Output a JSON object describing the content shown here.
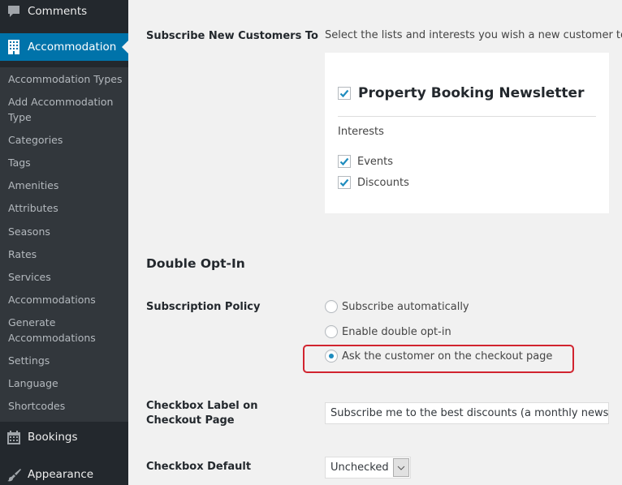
{
  "sidebar": {
    "top_items": [
      {
        "label": "Comments",
        "icon": "comment-icon"
      },
      {
        "label": "Accommodation",
        "icon": "building-icon",
        "active": true
      },
      {
        "label": "Bookings",
        "icon": "calendar-icon"
      },
      {
        "label": "Appearance",
        "icon": "paintbrush-icon"
      }
    ],
    "submenu": [
      "Accommodation Types",
      "Add Accommodation Type",
      "Categories",
      "Tags",
      "Amenities",
      "Attributes",
      "Seasons",
      "Rates",
      "Services",
      "Accommodations",
      "Generate Accommodations",
      "Settings",
      "Language",
      "Shortcodes"
    ]
  },
  "settings": {
    "subscribe_label": "Subscribe New Customers To",
    "subscribe_desc": "Select the lists and interests you wish a new customer to be",
    "list": {
      "name": "Property Booking Newsletter",
      "checked": true
    },
    "interests_title": "Interests",
    "interests": [
      {
        "label": "Events",
        "checked": true
      },
      {
        "label": "Discounts",
        "checked": true
      }
    ],
    "double_optin_title": "Double Opt-In",
    "policy_label": "Subscription Policy",
    "policy_options": [
      {
        "label": "Subscribe automatically",
        "selected": false
      },
      {
        "label": "Enable double opt-in",
        "selected": false
      },
      {
        "label": "Ask the customer on the checkout page",
        "selected": true
      }
    ],
    "checkbox_label_label": "Checkbox Label on Checkout Page",
    "checkbox_label_value": "Subscribe me to the best discounts (a monthly newslett",
    "checkbox_default_label": "Checkbox Default",
    "checkbox_default_value": "Unchecked"
  },
  "colors": {
    "accent": "#0073aa",
    "sidebar_bg": "#23282d",
    "submenu_bg": "#32373c",
    "highlight": "#d1242f",
    "check": "#1e8cbe"
  }
}
